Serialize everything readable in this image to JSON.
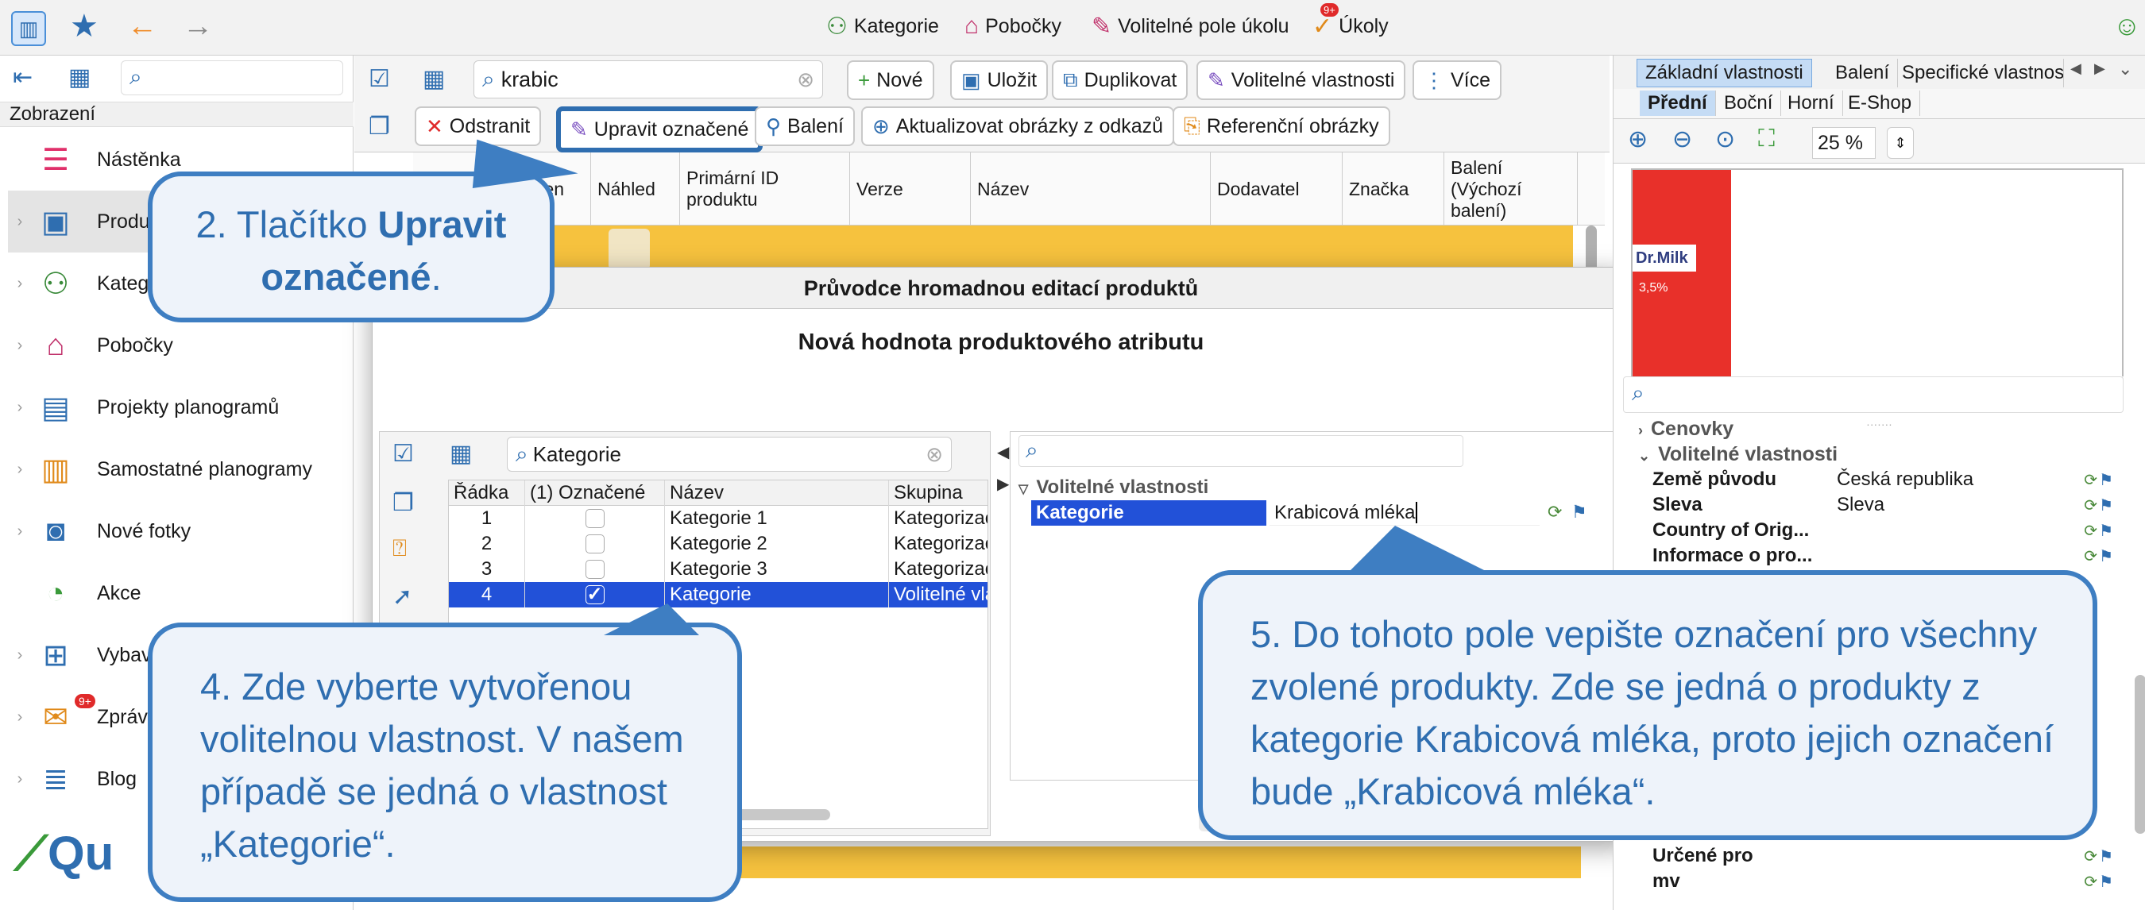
{
  "top_nav": [
    "Kategorie",
    "Pobočky",
    "Volitelné pole úkolu",
    "Úkoly"
  ],
  "badges": {
    "tasks": "9+",
    "messages": "9+"
  },
  "sidebar": {
    "header": "Zobrazení",
    "items": [
      {
        "label": "Nástěnka",
        "icon": "dashboard-icon",
        "color": "#e0306a"
      },
      {
        "label": "Produkty",
        "icon": "products-icon",
        "color": "#2f6eb0",
        "selected": true
      },
      {
        "label": "Kategorie",
        "icon": "categories-icon",
        "color": "#3a8a3a"
      },
      {
        "label": "Pobočky",
        "icon": "branches-icon",
        "color": "#c0306a"
      },
      {
        "label": "Projekty planogramů",
        "icon": "planogram-projects-icon",
        "color": "#2f6eb0"
      },
      {
        "label": "Samostatné planogramy",
        "icon": "planograms-icon",
        "color": "#e08a1a"
      },
      {
        "label": "Nové fotky",
        "icon": "camera-icon",
        "color": "#2f6eb0"
      },
      {
        "label": "Akce",
        "icon": "promotions-icon",
        "color": "#3a9a3a"
      },
      {
        "label": "Vybavení",
        "icon": "equipment-icon",
        "color": "#2f6eb0"
      },
      {
        "label": "Zprávy",
        "icon": "messages-icon",
        "color": "#e08a1a"
      },
      {
        "label": "Blog",
        "icon": "blog-icon",
        "color": "#2f6eb0"
      }
    ]
  },
  "toolbar": {
    "search_value": "krabic",
    "btn_new": "Nové",
    "btn_save": "Uložit",
    "btn_duplicate": "Duplikovat",
    "btn_custom_props": "Volitelné vlastnosti",
    "btn_more": "Více",
    "btn_delete": "Odstranit",
    "btn_edit_selected": "Upravit označené",
    "btn_packaging": "Balení",
    "btn_update_images": "Aktualizovat obrázky z odkazů",
    "btn_reference_images": "Referenční obrázky"
  },
  "table": {
    "columns": [
      "Označen",
      "Náhled",
      "Primární ID produktu",
      "Verze",
      "Název",
      "Dodavatel",
      "Značka",
      "Balení (Výchozí balení)"
    ]
  },
  "dialog": {
    "title": "Průvodce hromadnou editací produktů",
    "subtitle": "Nová hodnota produktového atributu",
    "left_search": "Kategorie",
    "table_cols": [
      "Řádka",
      "(1) Označené",
      "Název",
      "Skupina"
    ],
    "rows": [
      {
        "row": "1",
        "checked": false,
        "name": "Kategorie 1",
        "group": "Kategorizace"
      },
      {
        "row": "2",
        "checked": false,
        "name": "Kategorie 2",
        "group": "Kategorizace"
      },
      {
        "row": "3",
        "checked": false,
        "name": "Kategorie 3",
        "group": "Kategorizace"
      },
      {
        "row": "4",
        "checked": true,
        "name": "Kategorie",
        "group": "Volitelné vlastnosti",
        "selected": true
      }
    ],
    "right_group": "Volitelné vlastnosti",
    "right_key": "Kategorie",
    "right_value": "Krabicová mléka"
  },
  "right_panel": {
    "tabs": [
      "Základní vlastnosti",
      "Balení",
      "Specifické vlastnosti"
    ],
    "view_tabs": [
      "Přední",
      "Boční",
      "Horní",
      "E-Shop"
    ],
    "zoom": "25 %",
    "image_brand": "Dr.Milk",
    "image_fat": "3,5%",
    "groups": [
      "Cenovky",
      "Volitelné vlastnosti"
    ],
    "properties": [
      {
        "key": "Země původu",
        "value": "Česká republika"
      },
      {
        "key": "Sleva",
        "value": "Sleva"
      },
      {
        "key": "Country of Orig...",
        "value": ""
      },
      {
        "key": "Informace o pro...",
        "value": ""
      },
      {
        "key": "Určené pro",
        "value": ""
      },
      {
        "key": "mv",
        "value": ""
      }
    ]
  },
  "logo": {
    "text": "Qu"
  },
  "callouts": {
    "step2_prefix": "2. Tlačítko ",
    "step2_bold": "Upravit označené",
    "step2_suffix": ".",
    "step4": "4. Zde vyberte vytvořenou volitelnou vlastnost. V našem případě se jedná o vlastnost „Kategorie“.",
    "step5": "5. Do tohoto pole vepište označení pro všechny zvolené produkty. Zde se jedná o produkty z kategorie Krabicová mléka, proto jejich označení bude „Krabicová mléka“."
  }
}
